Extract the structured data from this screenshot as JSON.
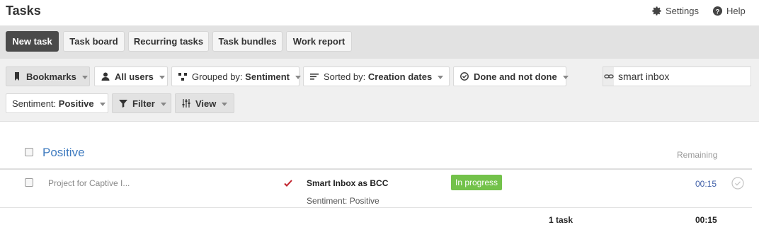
{
  "app": {
    "title": "Tasks"
  },
  "header": {
    "settings_label": "Settings",
    "help_label": "Help"
  },
  "tabs": [
    {
      "label": "New task"
    },
    {
      "label": "Task board"
    },
    {
      "label": "Recurring tasks"
    },
    {
      "label": "Task bundles"
    },
    {
      "label": "Work report"
    }
  ],
  "filters": {
    "bookmarks": "Bookmarks",
    "users": "All users",
    "grouped_prefix": "Grouped by:",
    "grouped_value": "Sentiment",
    "sorted_prefix": "Sorted by:",
    "sorted_value": "Creation dates",
    "status": "Done and not done",
    "sentiment_prefix": "Sentiment:",
    "sentiment_value": "Positive",
    "filter": "Filter",
    "view": "View"
  },
  "search": {
    "value": "smart inbox"
  },
  "group": {
    "title": "Positive",
    "remaining_label": "Remaining"
  },
  "tasks": [
    {
      "project": "Project for Captive I...",
      "title": "Smart Inbox as BCC",
      "sentiment": "Sentiment: Positive",
      "status": "In progress",
      "remaining": "00:15"
    }
  ],
  "summary": {
    "count": "1 task",
    "total": "00:15"
  },
  "colors": {
    "accent": "#3f7bbf",
    "status_green": "#73c24a",
    "primary_button": "#4a4a4a",
    "check_red": "#c0202a"
  },
  "icons": [
    "gear-icon",
    "help-icon",
    "bookmark-icon",
    "user-icon",
    "group-icon",
    "sort-icon",
    "status-check-icon",
    "filter-icon",
    "view-sliders-icon",
    "link-icon",
    "red-check-icon",
    "done-circle-icon"
  ]
}
